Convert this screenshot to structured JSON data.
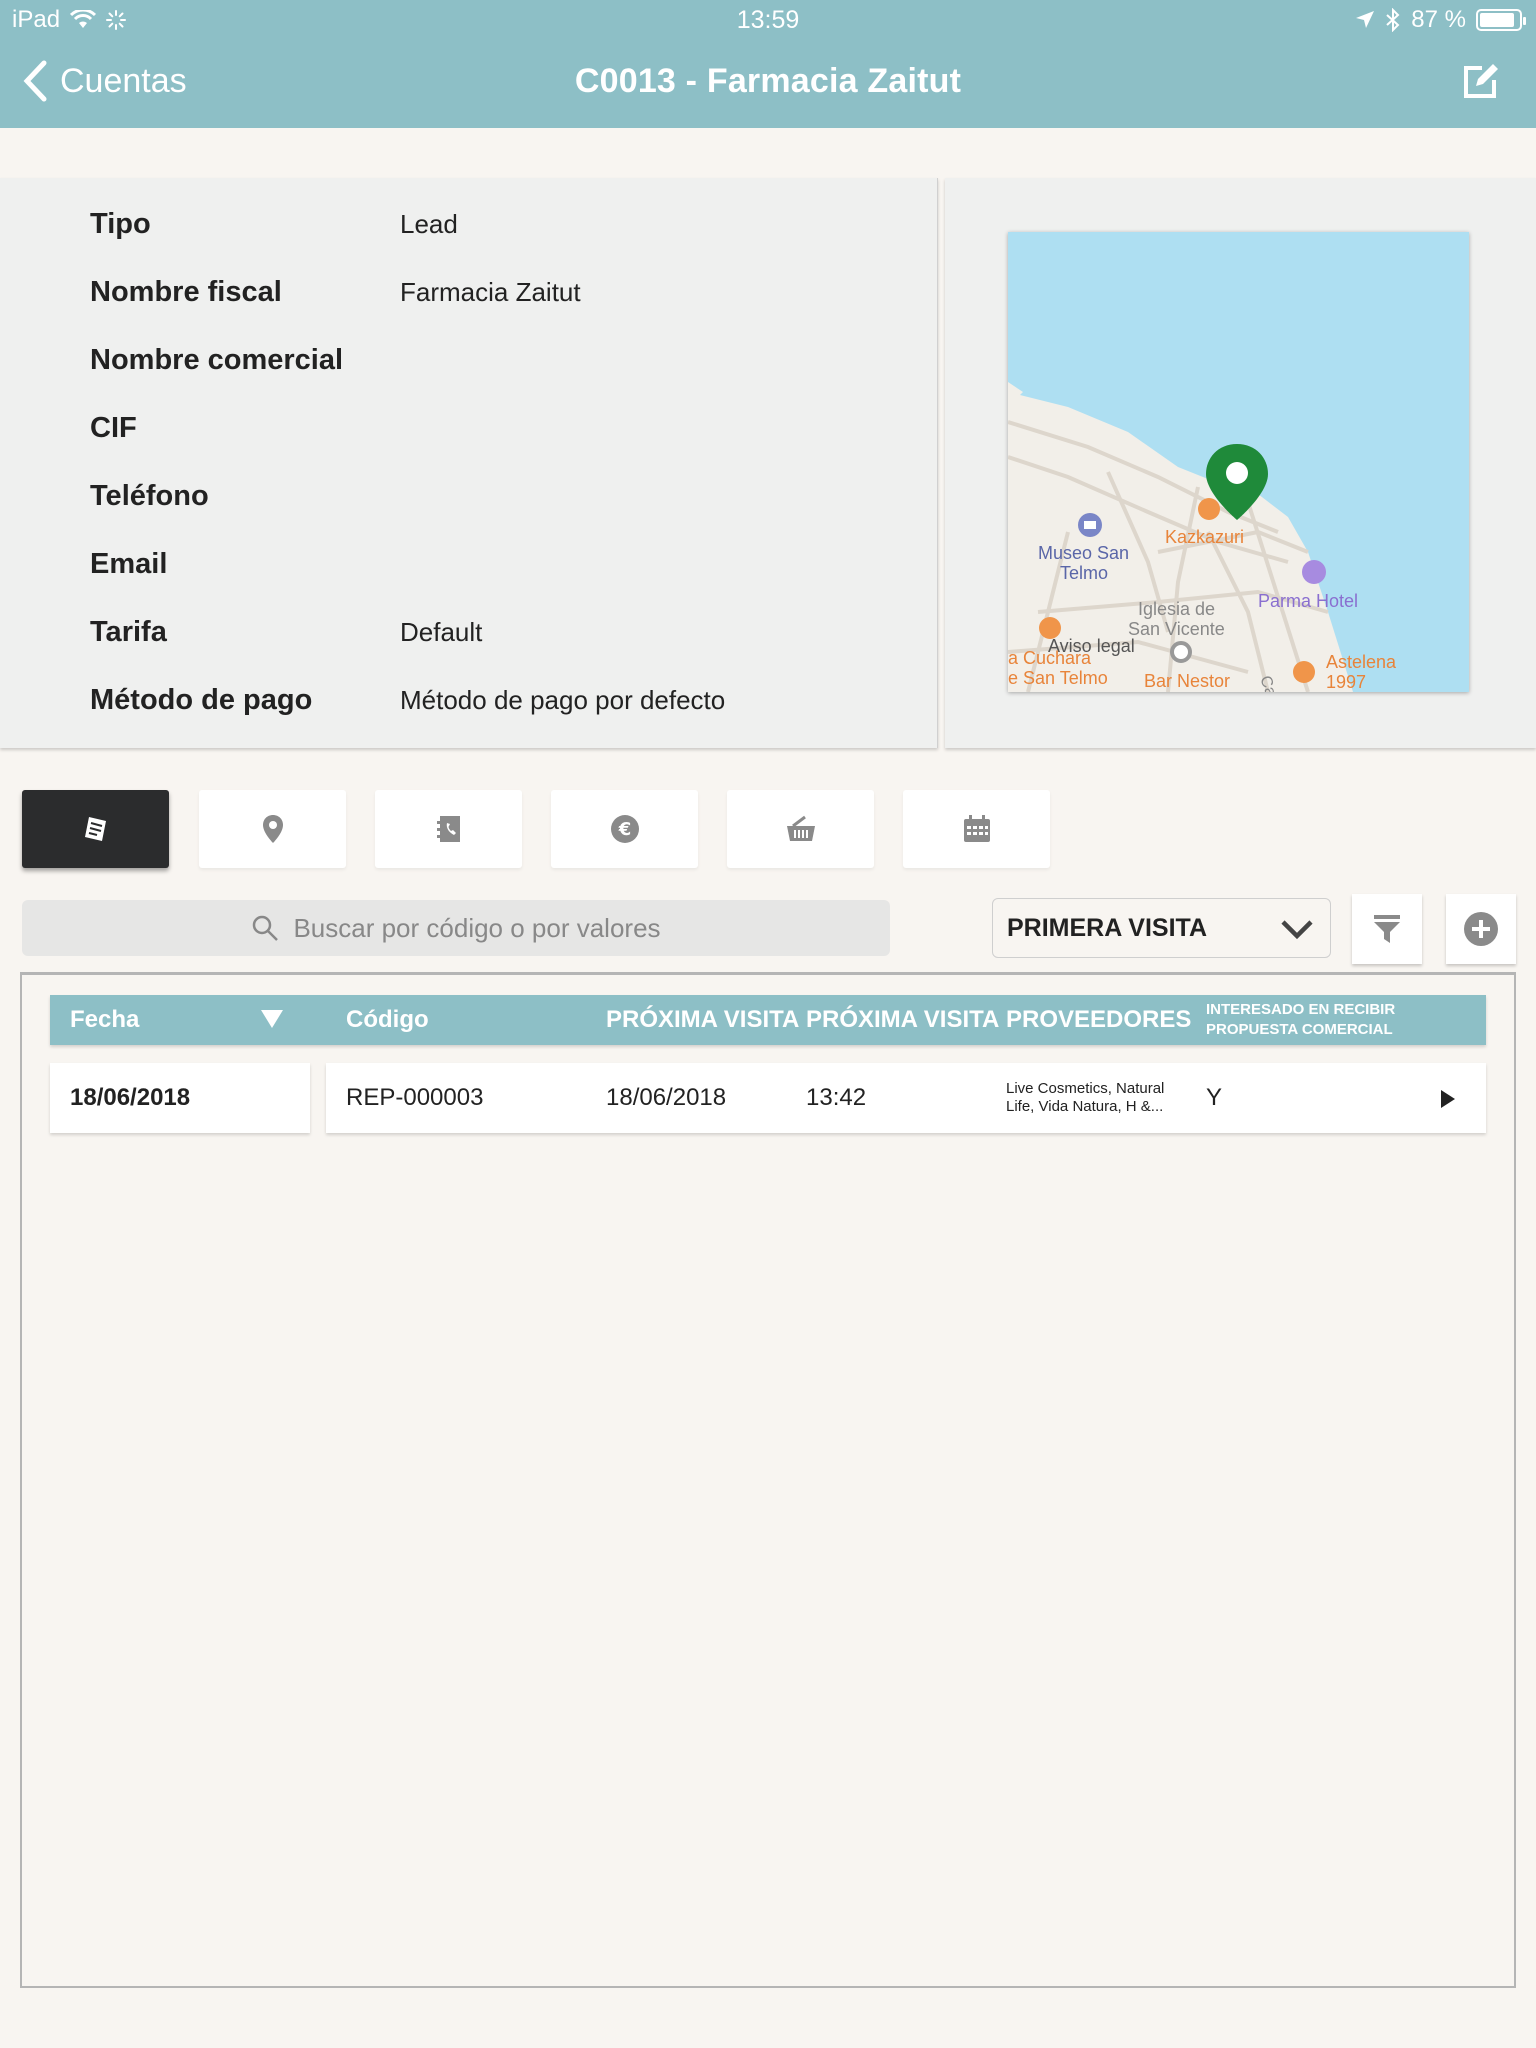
{
  "status": {
    "device": "iPad",
    "time": "13:59",
    "battery": "87 %"
  },
  "nav": {
    "back_label": "Cuentas",
    "title": "C0013 - Farmacia Zaitut"
  },
  "info": [
    {
      "label": "Tipo",
      "value": "Lead"
    },
    {
      "label": "Nombre fiscal",
      "value": "Farmacia Zaitut"
    },
    {
      "label": "Nombre comercial",
      "value": ""
    },
    {
      "label": "CIF",
      "value": ""
    },
    {
      "label": "Teléfono",
      "value": ""
    },
    {
      "label": "Email",
      "value": ""
    },
    {
      "label": "Tarifa",
      "value": "Default"
    },
    {
      "label": "Método de pago",
      "value": "Método de pago por defecto"
    }
  ],
  "map": {
    "labels": {
      "museo_1": "Museo San",
      "museo_2": "Telmo",
      "kazkazuri": "Kazkazuri",
      "parma": "Parma Hotel",
      "iglesia_1": "Iglesia de",
      "iglesia_2": "San Vicente",
      "aviso": "Aviso legal",
      "cuchara_1": "a Cuchara",
      "cuchara_2": "e San Telmo",
      "nestor": "Bar Nestor",
      "calle": "Call",
      "astelena_1": "Astelena",
      "astelena_2": "1997"
    },
    "colors": {
      "water": "#aedff2",
      "land": "#f2efe9",
      "pin": "#1f8a3a",
      "poi_food": "#f0954a",
      "poi_museum": "#7a86c7",
      "poi_hotel": "#a78be0"
    }
  },
  "tabs": [
    {
      "icon": "report-icon",
      "active": true
    },
    {
      "icon": "location-icon",
      "active": false
    },
    {
      "icon": "contacts-icon",
      "active": false
    },
    {
      "icon": "euro-icon",
      "active": false
    },
    {
      "icon": "basket-icon",
      "active": false
    },
    {
      "icon": "calendar-icon",
      "active": false
    }
  ],
  "search": {
    "placeholder": "Buscar por código o por valores"
  },
  "filter": {
    "selected": "PRIMERA VISITA"
  },
  "table": {
    "headers": {
      "fecha": "Fecha",
      "codigo": "Código",
      "proxima_visita_1": "PRÓXIMA VISITA",
      "proxima_visita_2": "PRÓXIMA VISITA",
      "proveedores": "PROVEEDORES",
      "interesado_1": "INTERESADO EN RECIBIR",
      "interesado_2": "PROPUESTA COMERCIAL"
    },
    "rows": [
      {
        "fecha": "18/06/2018",
        "codigo": "REP-000003",
        "proxima_fecha": "18/06/2018",
        "proxima_hora": "13:42",
        "proveedores_1": "Live Cosmetics, Natural",
        "proveedores_2": "Life, Vida Natura, H &...",
        "interesado": "Y"
      }
    ]
  },
  "colors": {
    "accent": "#8dbfc6",
    "dark_tab": "#2b2c2d",
    "background": "#f8f5f1"
  }
}
